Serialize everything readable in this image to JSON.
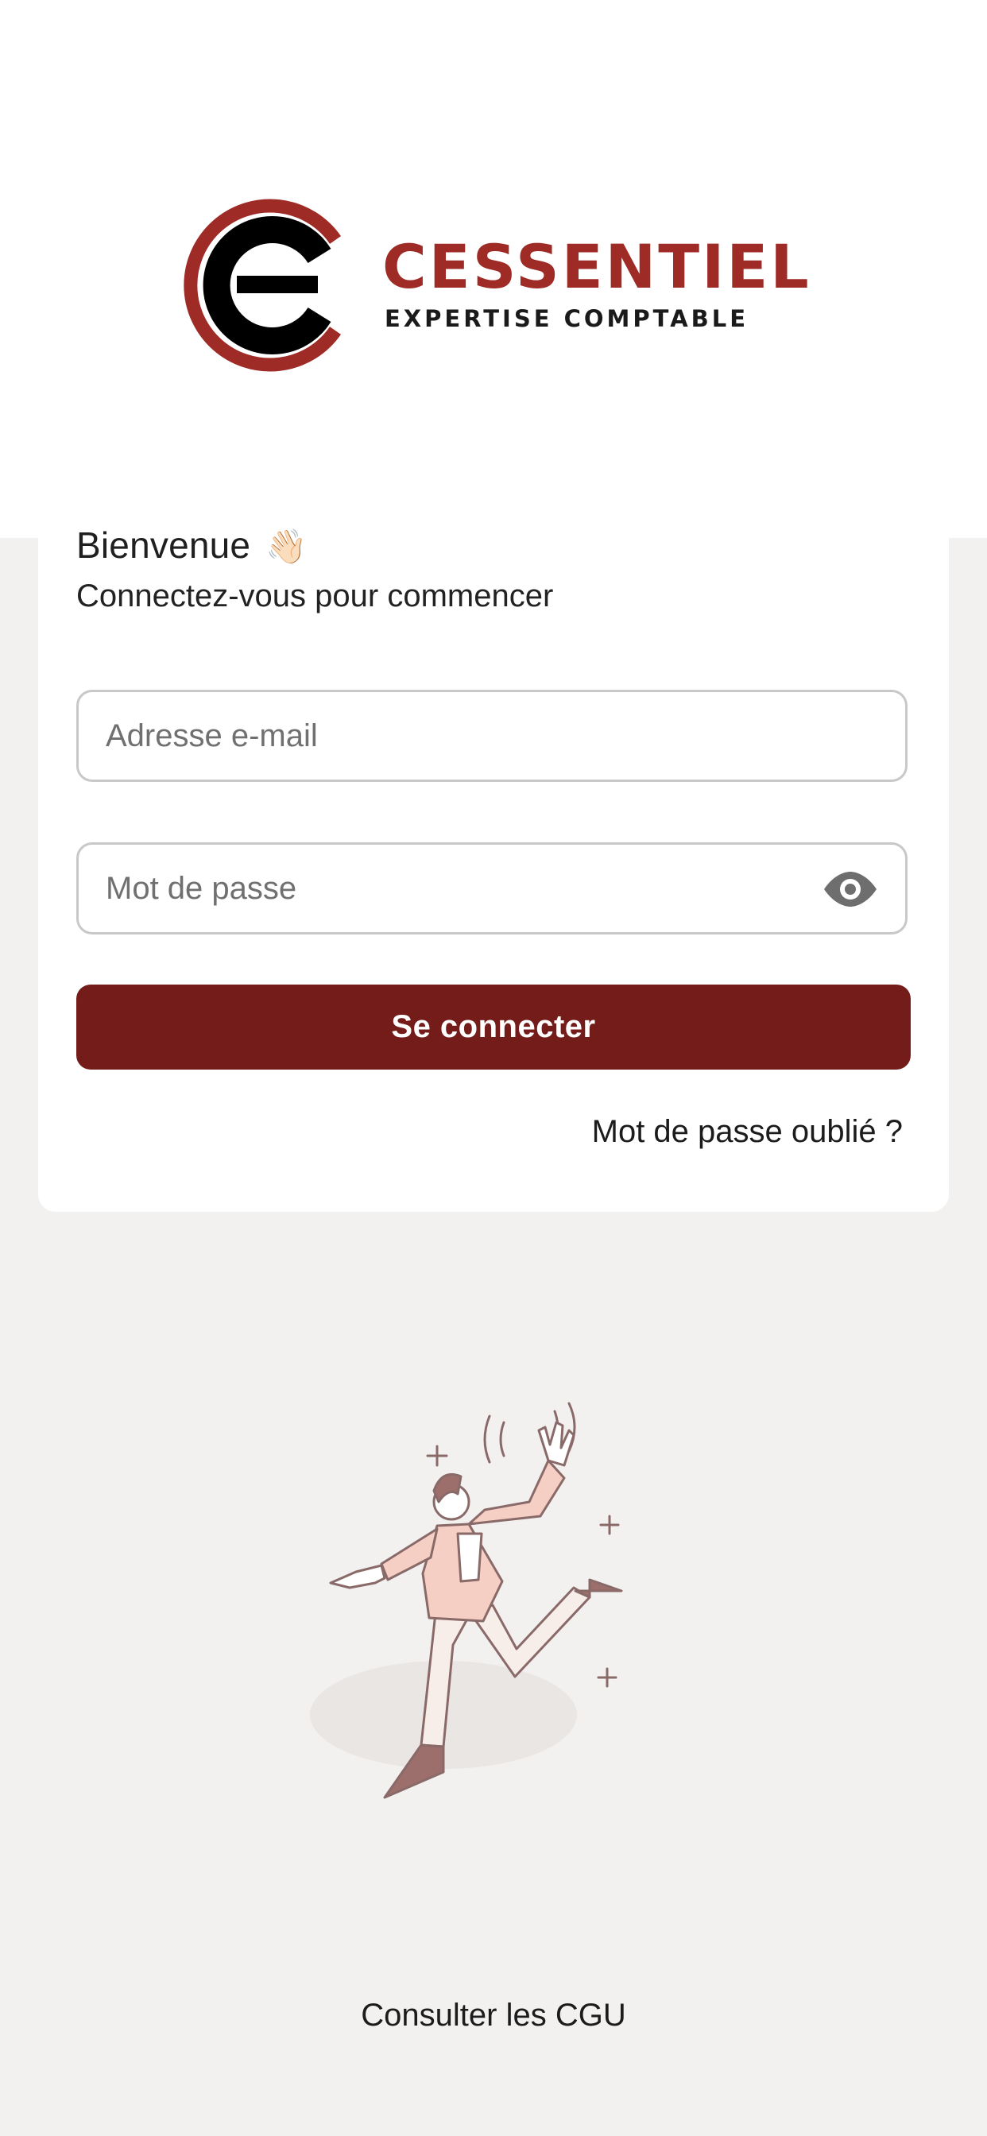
{
  "logo": {
    "brand_name": "CESSENTIEL",
    "tagline": "EXPERTISE COMPTABLE",
    "brand_color": "#9e2b25"
  },
  "login": {
    "title": "Bienvenue",
    "title_emoji": "👋🏻",
    "subtitle": "Connectez-vous pour commencer",
    "email_placeholder": "Adresse e-mail",
    "password_placeholder": "Mot de passe",
    "password_toggle_icon": "eye-icon",
    "submit_label": "Se connecter",
    "forgot_password_label": "Mot de passe oublié ?",
    "accent_color": "#731c19"
  },
  "footer": {
    "cgu_label": "Consulter les CGU"
  }
}
